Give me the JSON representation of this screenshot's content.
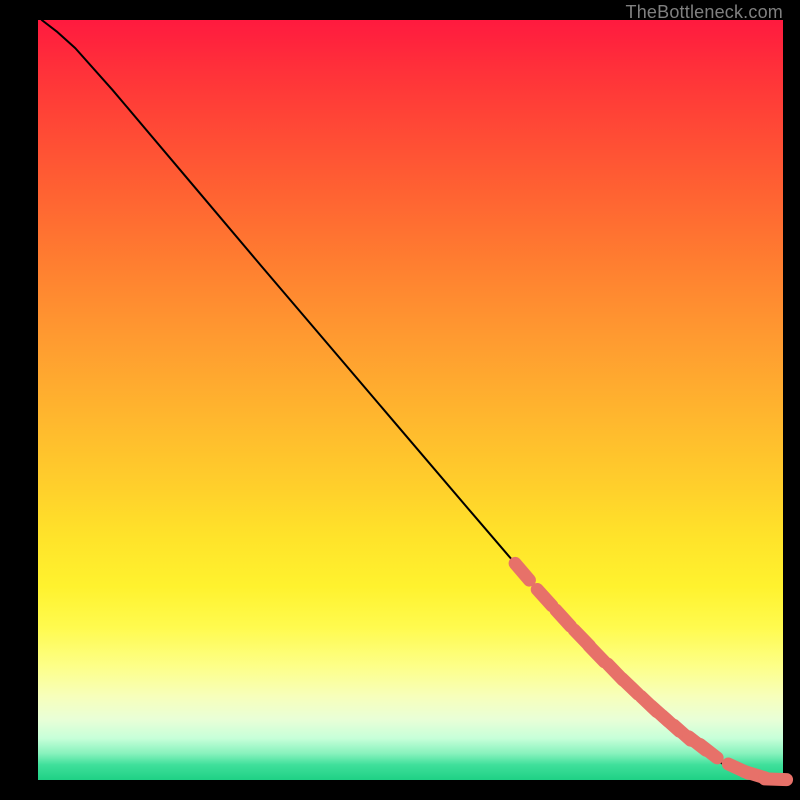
{
  "attribution": "TheBottleneck.com",
  "colors": {
    "marker": "#e77169",
    "line": "#000000",
    "background": "#000000"
  },
  "chart_data": {
    "type": "line",
    "title": "",
    "xlabel": "",
    "ylabel": "",
    "xlim": [
      0,
      100
    ],
    "ylim": [
      0,
      100
    ],
    "grid": false,
    "series": [
      {
        "name": "curve",
        "type": "line",
        "x": [
          0.5,
          2.5,
          5,
          10,
          20,
          30,
          40,
          50,
          58,
          65,
          72,
          78,
          83,
          87,
          90,
          92.5,
          94.5,
          96.5,
          98.5,
          100
        ],
        "y": [
          100,
          98.5,
          96.3,
          90.8,
          79.2,
          67.6,
          56.1,
          44.6,
          35.4,
          27.4,
          19.8,
          13.7,
          9.0,
          5.5,
          3.2,
          1.8,
          0.9,
          0.3,
          0.05,
          0.0
        ]
      },
      {
        "name": "markers",
        "type": "scatter",
        "x": [
          65,
          68,
          70.5,
          73,
          75,
          77.5,
          79.5,
          82,
          83.5,
          85,
          86.5,
          88.5,
          90,
          94,
          96.2,
          99.0
        ],
        "y": [
          27.4,
          24.0,
          21.3,
          18.7,
          16.6,
          14.2,
          12.3,
          10.0,
          8.7,
          7.4,
          6.2,
          4.8,
          3.8,
          1.5,
          0.7,
          0.1
        ]
      }
    ]
  }
}
